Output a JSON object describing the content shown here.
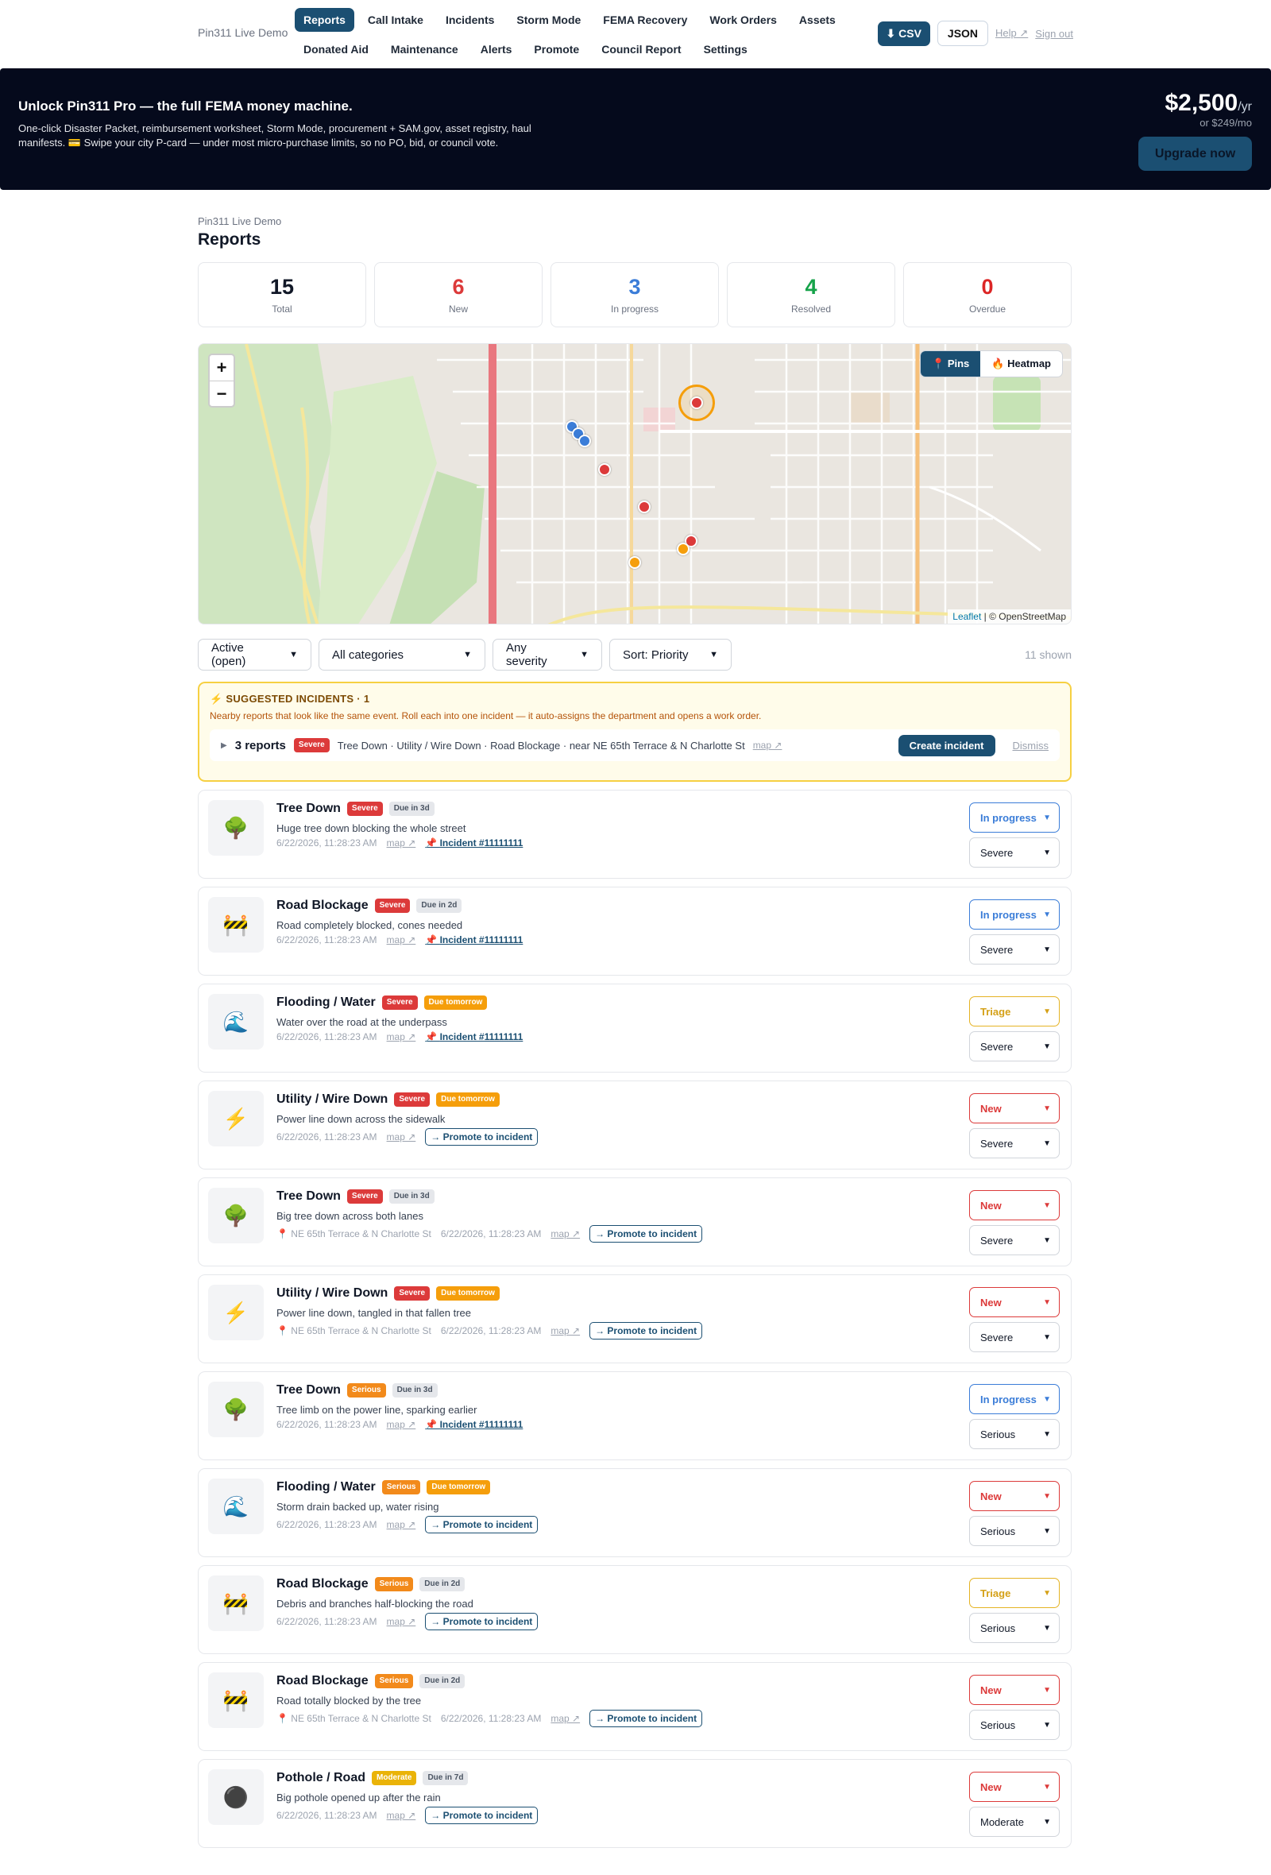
{
  "brand": "Pin311 Live Demo",
  "nav": {
    "row1": [
      "Reports",
      "Call Intake",
      "Incidents",
      "Storm Mode",
      "FEMA Recovery",
      "Work Orders",
      "Assets"
    ],
    "row2": [
      "Donated Aid",
      "Maintenance",
      "Alerts",
      "Promote",
      "Council Report",
      "Settings"
    ],
    "csv": "⬇ CSV",
    "json": "JSON",
    "help": "Help ↗",
    "signout": "Sign out"
  },
  "promo": {
    "title": "Unlock Pin311 Pro — the full FEMA money machine.",
    "desc": "One-click Disaster Packet, reimbursement worksheet, Storm Mode, procurement + SAM.gov, asset registry, haul manifests. 💳 Swipe your city P-card — under most micro-purchase limits, so no PO, bid, or council vote.",
    "price": "$2,500",
    "per": "/yr",
    "alt": "or $249/mo",
    "cta": "Upgrade now"
  },
  "header": {
    "crumb": "Pin311 Live Demo",
    "title": "Reports"
  },
  "stats": [
    {
      "value": "15",
      "label": "Total",
      "color": "#111827"
    },
    {
      "value": "6",
      "label": "New",
      "color": "#dc3a3a"
    },
    {
      "value": "3",
      "label": "In progress",
      "color": "#3b7dd8"
    },
    {
      "value": "4",
      "label": "Resolved",
      "color": "#16a34a"
    },
    {
      "value": "0",
      "label": "Overdue",
      "color": "#dc2626"
    }
  ],
  "map": {
    "zoom_in": "+",
    "zoom_out": "−",
    "pins_label": "📍 Pins",
    "heatmap_label": "🔥 Heatmap",
    "attribution_leaflet": "Leaflet",
    "attribution_rest": " | © OpenStreetMap"
  },
  "filters": {
    "status": "Active (open)",
    "category": "All categories",
    "severity": "Any severity",
    "sort": "Sort: Priority",
    "shown": "11 shown"
  },
  "suggested": {
    "title": "⚡ SUGGESTED INCIDENTS · 1",
    "desc": "Nearby reports that look like the same event. Roll each into one incident — it auto-assigns the department and opens a work order.",
    "count": "3 reports",
    "badge": "Severe",
    "summary": "Tree Down · Utility / Wire Down · Road Blockage · near NE 65th Terrace & N Charlotte St",
    "map": "map ↗",
    "create": "Create incident",
    "dismiss": "Dismiss"
  },
  "reports": [
    {
      "icon": "🌳",
      "title": "Tree Down",
      "sev": "Severe",
      "due": "Due in 3d",
      "due_soon": false,
      "desc": "Huge tree down blocking the whole street",
      "loc": "",
      "time": "6/22/2026, 11:28:23 AM",
      "map": "map ↗",
      "incident": "Incident #11111111",
      "promote": "",
      "status": "In progress",
      "status_kind": "prog",
      "sev_sel": "Severe"
    },
    {
      "icon": "🚧",
      "title": "Road Blockage",
      "sev": "Severe",
      "due": "Due in 2d",
      "due_soon": false,
      "desc": "Road completely blocked, cones needed",
      "loc": "",
      "time": "6/22/2026, 11:28:23 AM",
      "map": "map ↗",
      "incident": "Incident #11111111",
      "promote": "",
      "status": "In progress",
      "status_kind": "prog",
      "sev_sel": "Severe"
    },
    {
      "icon": "🌊",
      "title": "Flooding / Water",
      "sev": "Severe",
      "due": "Due tomorrow",
      "due_soon": true,
      "desc": "Water over the road at the underpass",
      "loc": "",
      "time": "6/22/2026, 11:28:23 AM",
      "map": "map ↗",
      "incident": "Incident #11111111",
      "promote": "",
      "status": "Triage",
      "status_kind": "triage",
      "sev_sel": "Severe"
    },
    {
      "icon": "⚡",
      "title": "Utility / Wire Down",
      "sev": "Severe",
      "due": "Due tomorrow",
      "due_soon": true,
      "desc": "Power line down across the sidewalk",
      "loc": "",
      "time": "6/22/2026, 11:28:23 AM",
      "map": "map ↗",
      "incident": "",
      "promote": "→ Promote to incident",
      "status": "New",
      "status_kind": "new",
      "sev_sel": "Severe"
    },
    {
      "icon": "🌳",
      "title": "Tree Down",
      "sev": "Severe",
      "due": "Due in 3d",
      "due_soon": false,
      "desc": "Big tree down across both lanes",
      "loc": "NE 65th Terrace & N Charlotte St",
      "time": "6/22/2026, 11:28:23 AM",
      "map": "map ↗",
      "incident": "",
      "promote": "→ Promote to incident",
      "status": "New",
      "status_kind": "new",
      "sev_sel": "Severe"
    },
    {
      "icon": "⚡",
      "title": "Utility / Wire Down",
      "sev": "Severe",
      "due": "Due tomorrow",
      "due_soon": true,
      "desc": "Power line down, tangled in that fallen tree",
      "loc": "NE 65th Terrace & N Charlotte St",
      "time": "6/22/2026, 11:28:23 AM",
      "map": "map ↗",
      "incident": "",
      "promote": "→ Promote to incident",
      "status": "New",
      "status_kind": "new",
      "sev_sel": "Severe"
    },
    {
      "icon": "🌳",
      "title": "Tree Down",
      "sev": "Serious",
      "due": "Due in 3d",
      "due_soon": false,
      "desc": "Tree limb on the power line, sparking earlier",
      "loc": "",
      "time": "6/22/2026, 11:28:23 AM",
      "map": "map ↗",
      "incident": "Incident #11111111",
      "promote": "",
      "status": "In progress",
      "status_kind": "prog",
      "sev_sel": "Serious"
    },
    {
      "icon": "🌊",
      "title": "Flooding / Water",
      "sev": "Serious",
      "due": "Due tomorrow",
      "due_soon": true,
      "desc": "Storm drain backed up, water rising",
      "loc": "",
      "time": "6/22/2026, 11:28:23 AM",
      "map": "map ↗",
      "incident": "",
      "promote": "→ Promote to incident",
      "status": "New",
      "status_kind": "new",
      "sev_sel": "Serious"
    },
    {
      "icon": "🚧",
      "title": "Road Blockage",
      "sev": "Serious",
      "due": "Due in 2d",
      "due_soon": false,
      "desc": "Debris and branches half-blocking the road",
      "loc": "",
      "time": "6/22/2026, 11:28:23 AM",
      "map": "map ↗",
      "incident": "",
      "promote": "→ Promote to incident",
      "status": "Triage",
      "status_kind": "triage",
      "sev_sel": "Serious"
    },
    {
      "icon": "🚧",
      "title": "Road Blockage",
      "sev": "Serious",
      "due": "Due in 2d",
      "due_soon": false,
      "desc": "Road totally blocked by the tree",
      "loc": "NE 65th Terrace & N Charlotte St",
      "time": "6/22/2026, 11:28:23 AM",
      "map": "map ↗",
      "incident": "",
      "promote": "→ Promote to incident",
      "status": "New",
      "status_kind": "new",
      "sev_sel": "Serious"
    },
    {
      "icon": "⚫",
      "title": "Pothole / Road",
      "sev": "Moderate",
      "due": "Due in 7d",
      "due_soon": false,
      "desc": "Big pothole opened up after the rain",
      "loc": "",
      "time": "6/22/2026, 11:28:23 AM",
      "map": "map ↗",
      "incident": "",
      "promote": "→ Promote to incident",
      "status": "New",
      "status_kind": "new",
      "sev_sel": "Moderate"
    }
  ]
}
